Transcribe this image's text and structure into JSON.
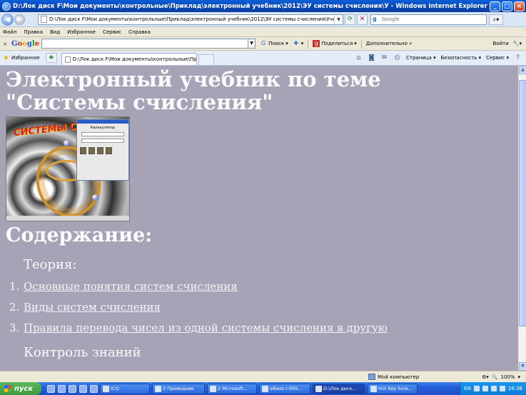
{
  "window": {
    "title": "D:\\Лок диск F\\Мои документы\\контрольные\\Приклад\\электронный учебник\\2012\\ЭУ системы счисления\\У - Windows Internet Explorer",
    "controls": [
      "_",
      "□",
      "×"
    ]
  },
  "address_bar": {
    "url": "D:\\Лок диск F\\Мои документы\\контрольные\\Приклад\\электронный учебник\\2012\\ЭУ системы счисления\\Учебник\\I.htm",
    "search_placeholder": "Google"
  },
  "menu": [
    "Файл",
    "Правка",
    "Вид",
    "Избранное",
    "Сервис",
    "Справка"
  ],
  "google_toolbar": {
    "logo": [
      "G",
      "o",
      "o",
      "g",
      "l",
      "e"
    ],
    "search_label": "Поиск",
    "share_label": "Поделиться",
    "more_label": "Дополнительно »",
    "signin_label": "Войти"
  },
  "favorites_bar": {
    "favorites_label": "Избранное",
    "tab_title": "D:\\Лок диск F\\Мои документы\\контрольные\\Прик...",
    "commands": [
      "Страница ▾",
      "Безопасность ▾",
      "Сервис ▾"
    ]
  },
  "content": {
    "title": "Электронный учебник по теме \"Системы счисления\"",
    "cover_logo": "СИСТЕМЫ СЧ",
    "cover_calc_title": "Калькулятор",
    "contents_heading": "Содержание:",
    "theory_heading": "Теория:",
    "toc": [
      {
        "num": "1.",
        "text": "Основные понятия систем счисления"
      },
      {
        "num": "2.",
        "text": "Виды систем счисления"
      },
      {
        "num": "3.",
        "text": "Правила перевода чисел из одной системы счисления в другую"
      }
    ],
    "control_heading": "Контроль знаний"
  },
  "status_bar": {
    "zone": "Мой компьютер",
    "zoom": "100%"
  },
  "taskbar": {
    "start_label": "пуск",
    "tasks": [
      {
        "label": "ICQ",
        "active": false
      },
      {
        "label": "2 Проводник",
        "active": false
      },
      {
        "label": "2 Microsoft...",
        "active": false
      },
      {
        "label": "albest-r-005...",
        "active": false
      },
      {
        "label": "D:\\Лок диск...",
        "active": true
      },
      {
        "label": "Hot Key Scre...",
        "active": false
      }
    ],
    "lang": "EN",
    "clock": "16:38"
  }
}
